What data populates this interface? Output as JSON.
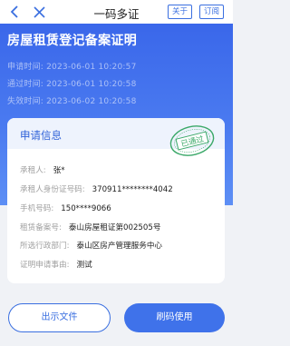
{
  "nav": {
    "title": "一码多证",
    "about_label": "关于",
    "subscribe_label": "订阅"
  },
  "header": {
    "title": "房屋租赁登记备案证明",
    "meta": [
      {
        "label": "申请时间:",
        "value": "2023-06-01 10:20:57"
      },
      {
        "label": "通过时间:",
        "value": "2023-06-01 10:20:58"
      },
      {
        "label": "失效时间:",
        "value": "2023-06-02 10:20:58"
      }
    ]
  },
  "card": {
    "title": "申请信息",
    "stamp_text": "已通过",
    "fields": [
      {
        "label": "承租人:",
        "value": "张*"
      },
      {
        "label": "承租人身份证号码:",
        "value": "370911********4042"
      },
      {
        "label": "手机号码:",
        "value": "150****9066"
      },
      {
        "label": "租赁备案号:",
        "value": "泰山房屋租证第002505号"
      },
      {
        "label": "所选行政部门:",
        "value": "泰山区房产管理服务中心"
      },
      {
        "label": "证明申请事由:",
        "value": "测试"
      }
    ]
  },
  "actions": {
    "show_file_label": "出示文件",
    "scan_use_label": "刷码使用"
  },
  "colors": {
    "primary": "#3a6fe0",
    "stamp": "#3aa868"
  }
}
